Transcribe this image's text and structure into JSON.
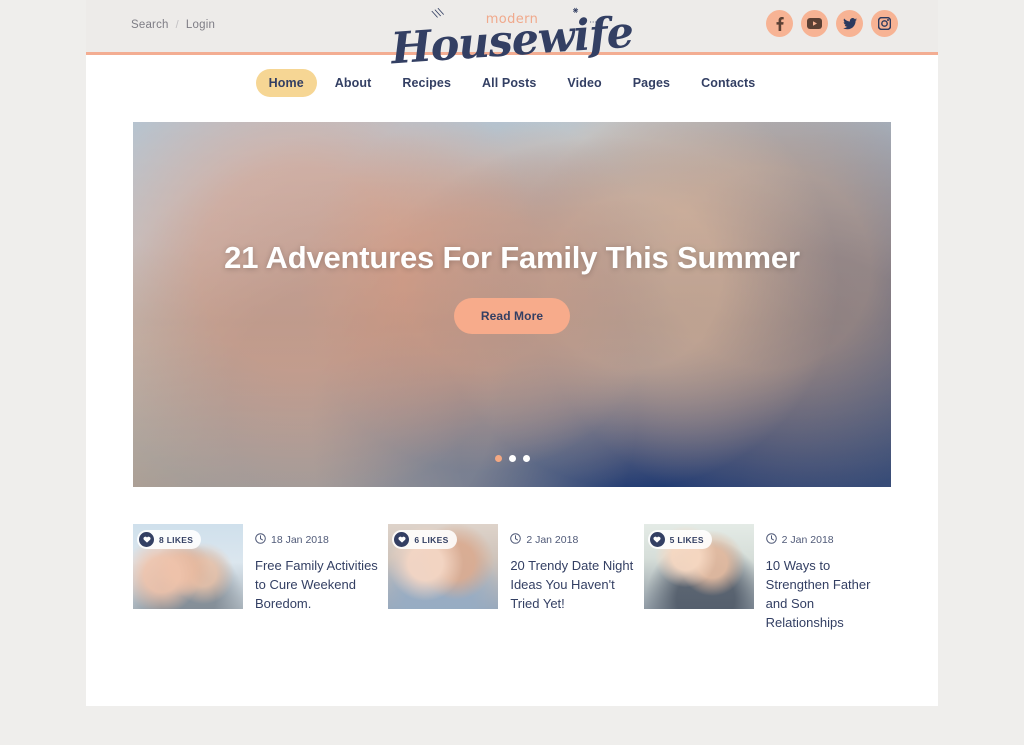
{
  "topbar": {
    "search_label": "Search",
    "separator": "/",
    "login_label": "Login"
  },
  "logo": {
    "pre": "modern",
    "name": "Housewife"
  },
  "socials": [
    {
      "name": "facebook",
      "icon": "facebook-icon"
    },
    {
      "name": "youtube",
      "icon": "youtube-icon"
    },
    {
      "name": "twitter",
      "icon": "twitter-icon"
    },
    {
      "name": "instagram",
      "icon": "instagram-icon"
    }
  ],
  "nav": {
    "items": [
      {
        "label": "Home",
        "active": true
      },
      {
        "label": "About",
        "active": false
      },
      {
        "label": "Recipes",
        "active": false
      },
      {
        "label": "All Posts",
        "active": false
      },
      {
        "label": "Video",
        "active": false
      },
      {
        "label": "Pages",
        "active": false
      },
      {
        "label": "Contacts",
        "active": false
      }
    ]
  },
  "hero": {
    "title": "21 Adventures For Family This Summer",
    "button_label": "Read More",
    "slides": 3,
    "active_slide": 1
  },
  "posts": [
    {
      "likes": "8 LIKES",
      "date": "18 Jan 2018",
      "title": "Free Family Activities to Cure Weekend Boredom."
    },
    {
      "likes": "6 LIKES",
      "date": "2 Jan 2018",
      "title": "20 Trendy Date Night Ideas You Haven't Tried Yet!"
    },
    {
      "likes": "5 LIKES",
      "date": "2 Jan 2018",
      "title": "10 Ways to Strengthen Father and Son Relationships"
    }
  ],
  "colors": {
    "page_bg": "#efeeec",
    "content_bg": "#ffffff",
    "topbar_bg": "#edebe9",
    "accent_peach": "#f7b394",
    "accent_rule": "#f3ad92",
    "nav_active": "#f6d694",
    "navy": "#333f63",
    "muted_text": "#7e7d85"
  }
}
